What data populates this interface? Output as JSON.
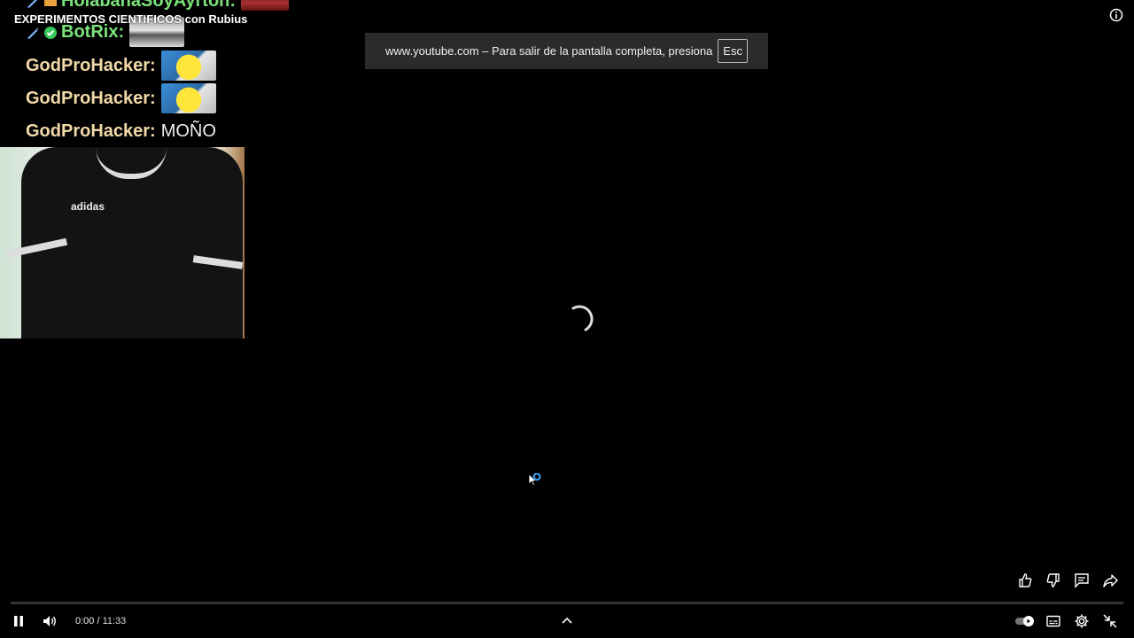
{
  "video": {
    "title": "EXPERIMENTOS CIENTIFICOS con Rubius"
  },
  "chat": [
    {
      "user": "HolabanaSoyAyrton:",
      "message": "",
      "emote": "red",
      "badges": true,
      "user_color": "green"
    },
    {
      "user": "BotRix:",
      "message": "",
      "emote": "img",
      "badges": true,
      "user_color": "green"
    },
    {
      "user": "GodProHacker:",
      "message": "",
      "emote": "pikachu",
      "badges": false,
      "user_color": "tan"
    },
    {
      "user": "GodProHacker:",
      "message": "",
      "emote": "pikachu",
      "badges": false,
      "user_color": "tan"
    },
    {
      "user": "GodProHacker:",
      "message": "MOÑO",
      "emote": "",
      "badges": false,
      "user_color": "tan"
    }
  ],
  "webcam": {
    "shirt_logo": "adidas"
  },
  "fullscreen_notice": {
    "text": "www.youtube.com – Para salir de la pantalla completa, presiona",
    "key": "Esc"
  },
  "player": {
    "current_time": "0:00",
    "separator": " / ",
    "duration": "11:33",
    "progress": 0.0,
    "state": "loading"
  },
  "icons": {
    "info": "info-icon",
    "pause": "pause-icon",
    "volume": "volume-icon",
    "chevron": "chevron-up-icon",
    "autoplay": "autoplay-toggle-icon",
    "subtitles": "subtitles-icon",
    "settings": "gear-icon",
    "exit_fullscreen": "exit-fullscreen-icon",
    "like": "thumbs-up-icon",
    "dislike": "thumbs-down-icon",
    "comments": "comments-icon",
    "share": "share-icon"
  },
  "colors": {
    "background": "#000000",
    "notice_bg": "#2b2b2b",
    "accent": "#3ea6ff"
  }
}
